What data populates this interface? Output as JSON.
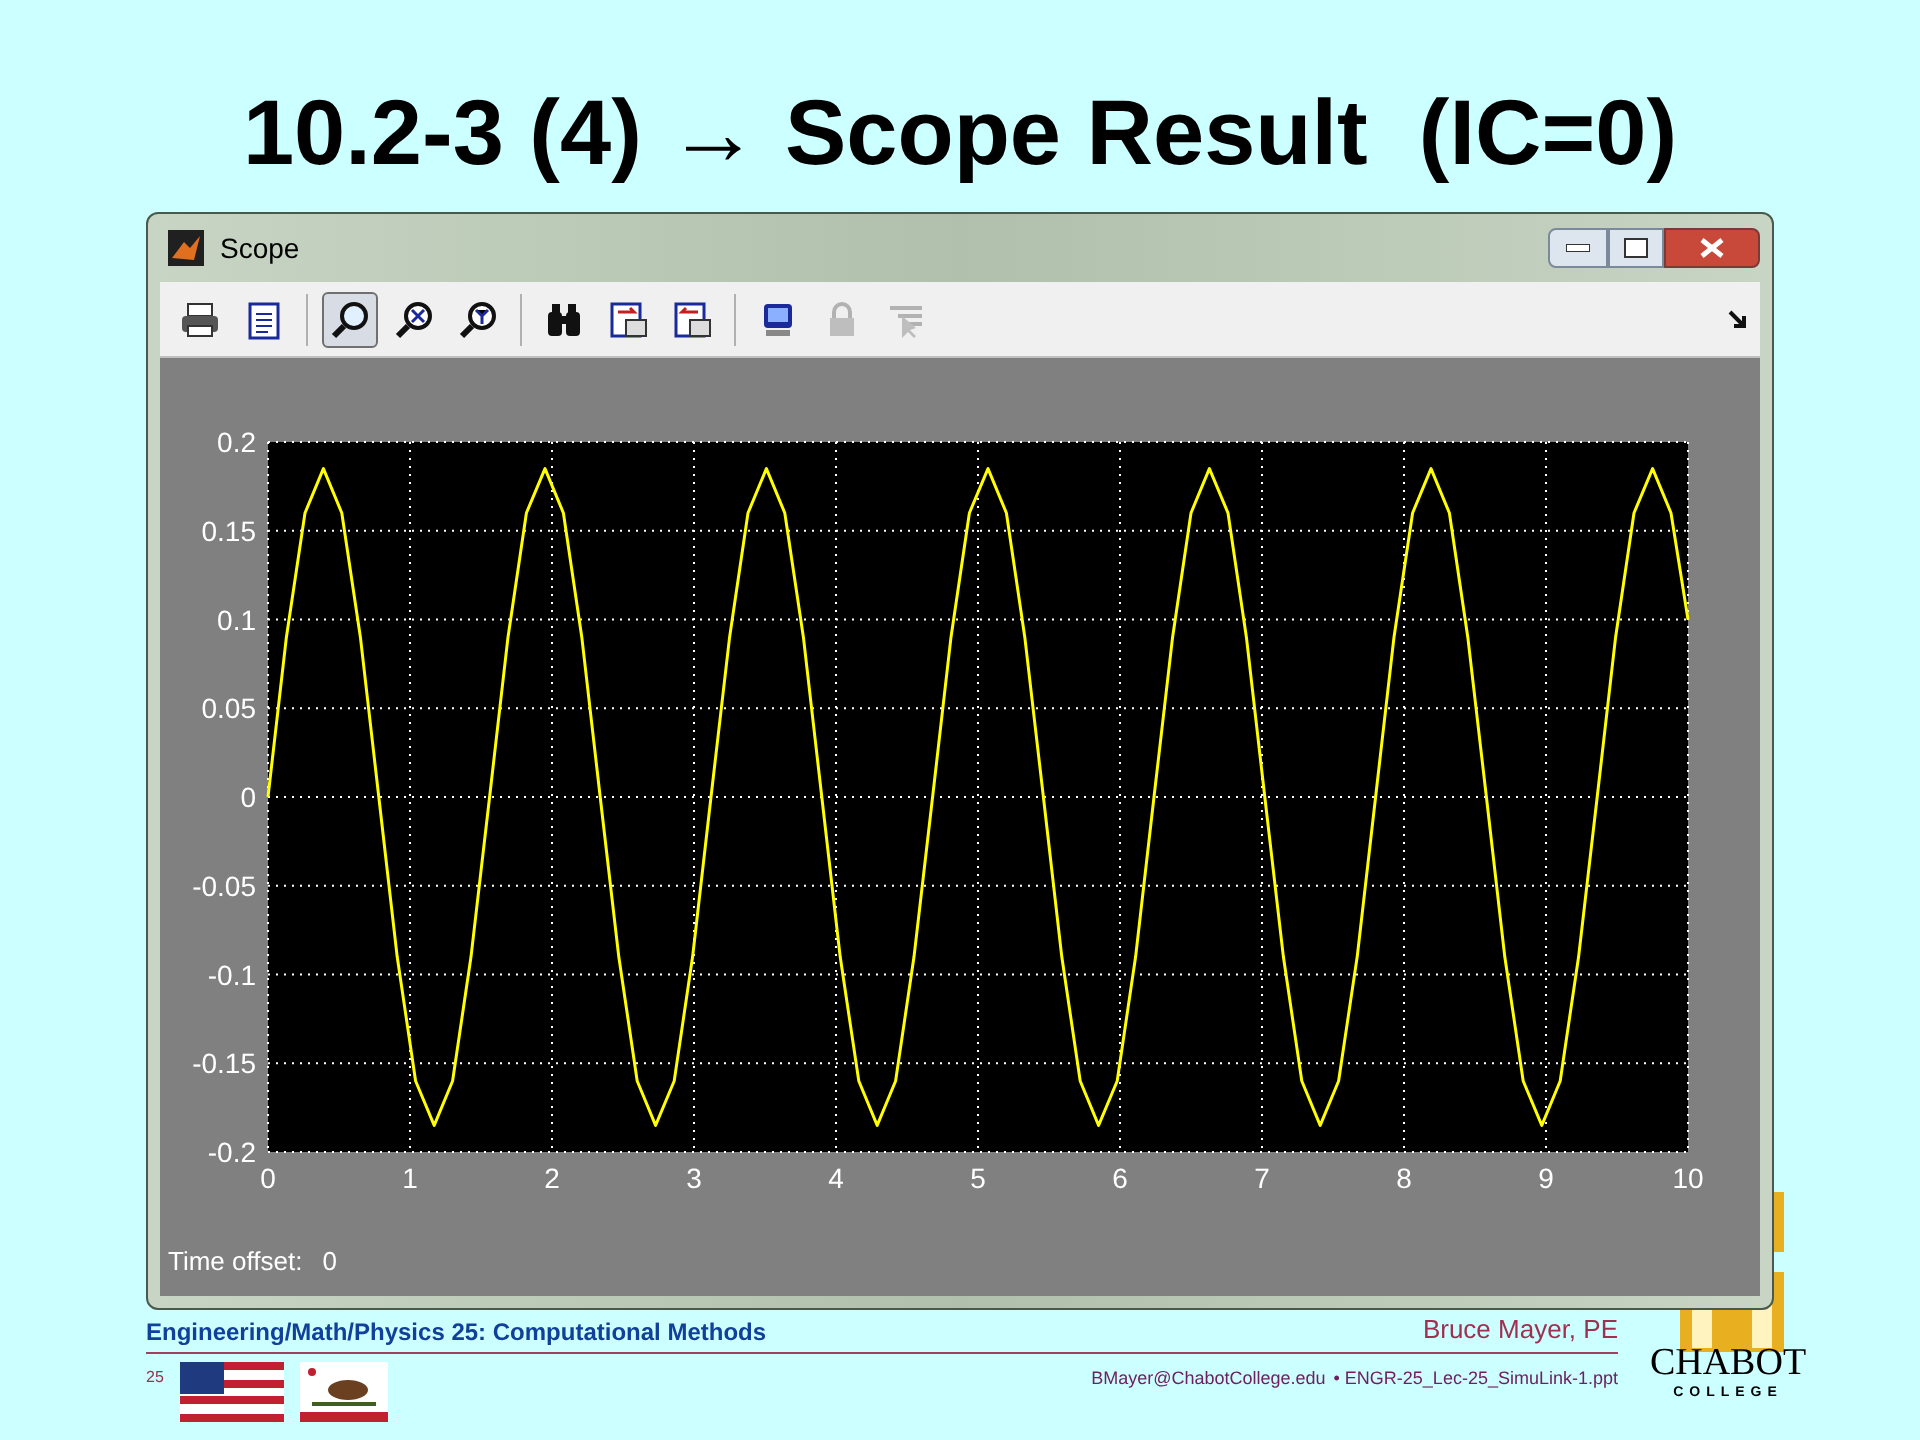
{
  "slide_title": "10.2-3 (4) → Scope Result  (IC=0)",
  "window": {
    "title": "Scope"
  },
  "tools": [
    {
      "selected": false,
      "disabled": false
    },
    {
      "selected": false,
      "disabled": false
    },
    {
      "selected": true,
      "disabled": false
    },
    {
      "selected": false,
      "disabled": false
    },
    {
      "selected": false,
      "disabled": false
    },
    {
      "selected": false,
      "disabled": false
    },
    {
      "selected": false,
      "disabled": false
    },
    {
      "selected": false,
      "disabled": false
    },
    {
      "selected": false,
      "disabled": false
    },
    {
      "selected": false,
      "disabled": true
    },
    {
      "selected": false,
      "disabled": true
    }
  ],
  "scope": {
    "chart_data": {
      "type": "line",
      "grid": true,
      "xlim": [
        0,
        10
      ],
      "ylim": [
        -0.2,
        0.2
      ],
      "xticks": [
        0,
        1,
        2,
        3,
        4,
        5,
        6,
        7,
        8,
        9,
        10
      ],
      "yticks": [
        -0.2,
        -0.15,
        -0.1,
        -0.05,
        0,
        0.05,
        0.1,
        0.15,
        0.2
      ],
      "x": [
        0,
        0.13,
        0.26,
        0.39,
        0.52,
        0.65,
        0.78,
        0.91,
        1.04,
        1.17,
        1.3,
        1.43,
        1.56,
        1.69,
        1.82,
        1.95,
        2.08,
        2.21,
        2.34,
        2.47,
        2.6,
        2.73,
        2.86,
        2.99,
        3.12,
        3.25,
        3.38,
        3.51,
        3.64,
        3.77,
        3.9,
        4.03,
        4.16,
        4.29,
        4.42,
        4.55,
        4.68,
        4.81,
        4.94,
        5.07,
        5.2,
        5.33,
        5.46,
        5.59,
        5.72,
        5.85,
        5.98,
        6.11,
        6.24,
        6.37,
        6.5,
        6.63,
        6.76,
        6.89,
        7.02,
        7.15,
        7.28,
        7.41,
        7.54,
        7.67,
        7.8,
        7.93,
        8.06,
        8.19,
        8.32,
        8.45,
        8.58,
        8.71,
        8.84,
        8.97,
        9.1,
        9.23,
        9.36,
        9.49,
        9.62,
        9.75,
        9.88,
        10
      ],
      "series": [
        {
          "color": "#ffff00",
          "values": [
            0,
            0.09,
            0.16,
            0.185,
            0.16,
            0.09,
            0,
            -0.09,
            -0.16,
            -0.185,
            -0.16,
            -0.09,
            0,
            0.09,
            0.16,
            0.185,
            0.16,
            0.09,
            0,
            -0.09,
            -0.16,
            -0.185,
            -0.16,
            -0.09,
            0,
            0.09,
            0.16,
            0.185,
            0.16,
            0.09,
            0,
            -0.09,
            -0.16,
            -0.185,
            -0.16,
            -0.09,
            0,
            0.09,
            0.16,
            0.185,
            0.16,
            0.09,
            0,
            -0.09,
            -0.16,
            -0.185,
            -0.16,
            -0.09,
            0,
            0.09,
            0.16,
            0.185,
            0.16,
            0.09,
            0,
            -0.09,
            -0.16,
            -0.185,
            -0.16,
            -0.09,
            0,
            0.09,
            0.16,
            0.185,
            0.16,
            0.09,
            0,
            -0.09,
            -0.16,
            -0.185,
            -0.16,
            -0.09,
            0,
            0.09,
            0.16,
            0.185,
            0.16,
            0.1
          ]
        }
      ]
    },
    "time_offset_label": "Time offset:",
    "time_offset_value": "0"
  },
  "footer": {
    "course": "Engineering/Math/Physics 25: Computational Methods",
    "author": "Bruce Mayer, PE",
    "page": "25",
    "email": "BMayer@ChabotCollege.edu",
    "file": "• ENGR-25_Lec-25_SimuLink-1.ppt",
    "logo_name": "CHABOT",
    "logo_sub": "COLLEGE"
  }
}
